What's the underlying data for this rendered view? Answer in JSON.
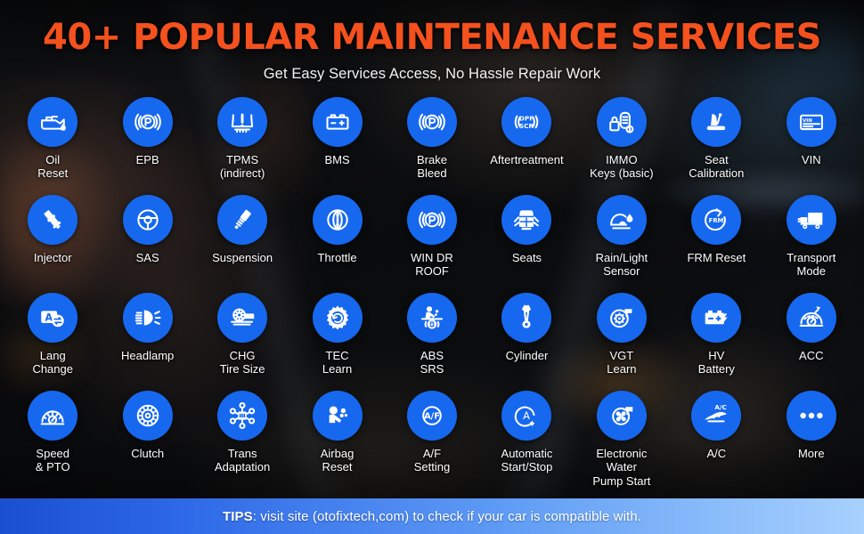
{
  "header": {
    "title": "40+ POPULAR MAINTENANCE SERVICES",
    "subtitle": "Get Easy Services Access, No Hassle Repair Work",
    "title_color": "#f4511e",
    "subtitle_color": "#f2f3f4"
  },
  "theme": {
    "badge_blue": "#1668ef",
    "footer_gradient_start": "#1a4fd0",
    "footer_gradient_end": "#a8d0fd",
    "background": "#0b0c0e"
  },
  "footer": {
    "tips_label": "TIPS",
    "tips_text": ": visit site (otofixtech,com) to check if your car is compatible with."
  },
  "services": [
    {
      "label": "Oil\nReset",
      "icon": "oil-can-icon"
    },
    {
      "label": "EPB",
      "icon": "parking-brake-icon"
    },
    {
      "label": "TPMS\n(indirect)",
      "icon": "tire-pressure-icon"
    },
    {
      "label": "BMS",
      "icon": "battery-icon"
    },
    {
      "label": "Brake\nBleed",
      "icon": "parking-brake-icon"
    },
    {
      "label": "Aftertreatment",
      "icon": "dpf-scr-icon"
    },
    {
      "label": "IMMO\nKeys (basic)",
      "icon": "immo-key-lock-icon"
    },
    {
      "label": "Seat\nCalibration",
      "icon": "car-seat-icon"
    },
    {
      "label": "VIN",
      "icon": "vin-card-icon"
    },
    {
      "label": "Injector",
      "icon": "fuel-injector-icon"
    },
    {
      "label": "SAS",
      "icon": "steering-wheel-icon"
    },
    {
      "label": "Suspension",
      "icon": "shock-absorber-icon"
    },
    {
      "label": "Throttle",
      "icon": "throttle-body-icon"
    },
    {
      "label": "WIN DR\nROOF",
      "icon": "parking-brake-icon"
    },
    {
      "label": "Seats",
      "icon": "car-top-seats-icon"
    },
    {
      "label": "Rain/Light\nSensor",
      "icon": "rain-light-sensor-icon"
    },
    {
      "label": "FRM Reset",
      "icon": "frm-reset-icon"
    },
    {
      "label": "Transport\nMode",
      "icon": "truck-icon"
    },
    {
      "label": "Lang\nChange",
      "icon": "language-swap-icon"
    },
    {
      "label": "Headlamp",
      "icon": "headlamp-icon"
    },
    {
      "label": "CHG\nTire Size",
      "icon": "change-tire-size-icon"
    },
    {
      "label": "TEC\nLearn",
      "icon": "gear-learn-icon"
    },
    {
      "label": "ABS\nSRS",
      "icon": "abs-srs-icon"
    },
    {
      "label": "Cylinder",
      "icon": "cylinder-icon"
    },
    {
      "label": "VGT\nLearn",
      "icon": "turbo-icon"
    },
    {
      "label": "HV\nBattery",
      "icon": "hv-battery-icon"
    },
    {
      "label": "ACC",
      "icon": "acc-gauge-icon"
    },
    {
      "label": "Speed\n& PTO",
      "icon": "speedometer-icon"
    },
    {
      "label": "Clutch",
      "icon": "clutch-disc-icon"
    },
    {
      "label": "Trans\nAdaptation",
      "icon": "transmission-network-icon"
    },
    {
      "label": "Airbag\nReset",
      "icon": "airbag-icon"
    },
    {
      "label": "A/F\nSetting",
      "icon": "af-setting-icon"
    },
    {
      "label": "Automatic\nStart/Stop",
      "icon": "auto-start-stop-icon"
    },
    {
      "label": "Electronic\nWater\nPump Start",
      "icon": "water-pump-icon"
    },
    {
      "label": "A/C",
      "icon": "ac-car-icon"
    },
    {
      "label": "More",
      "icon": "more-dots-icon"
    }
  ]
}
